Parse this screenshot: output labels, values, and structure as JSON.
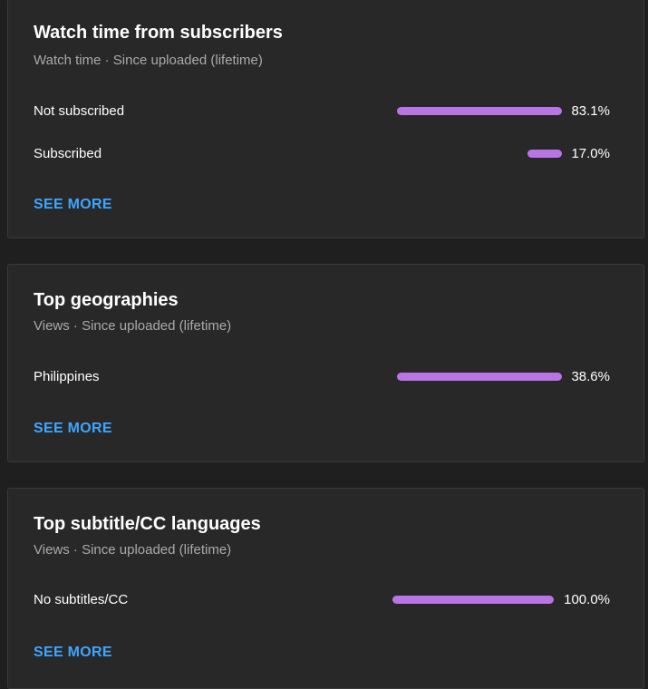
{
  "cards": [
    {
      "title": "Watch time from subscribers",
      "subtitle": "Watch time · Since uploaded (lifetime)",
      "rows": [
        {
          "label": "Not subscribed",
          "value_text": "83.1%",
          "value": 83.1
        },
        {
          "label": "Subscribed",
          "value_text": "17.0%",
          "value": 17.0
        }
      ],
      "see_more": "SEE MORE"
    },
    {
      "title": "Top geographies",
      "subtitle": "Views · Since uploaded (lifetime)",
      "rows": [
        {
          "label": "Philippines",
          "value_text": "38.6%",
          "value": 38.6
        }
      ],
      "see_more": "SEE MORE"
    },
    {
      "title": "Top subtitle/CC languages",
      "subtitle": "Views · Since uploaded (lifetime)",
      "rows": [
        {
          "label": "No subtitles/CC",
          "value_text": "100.0%",
          "value": 100.0
        }
      ],
      "see_more": "SEE MORE"
    }
  ],
  "colors": {
    "bar": "#b974e6",
    "link": "#3ea6ff",
    "card_bg": "#282828",
    "page_bg": "#1f1f1f"
  }
}
